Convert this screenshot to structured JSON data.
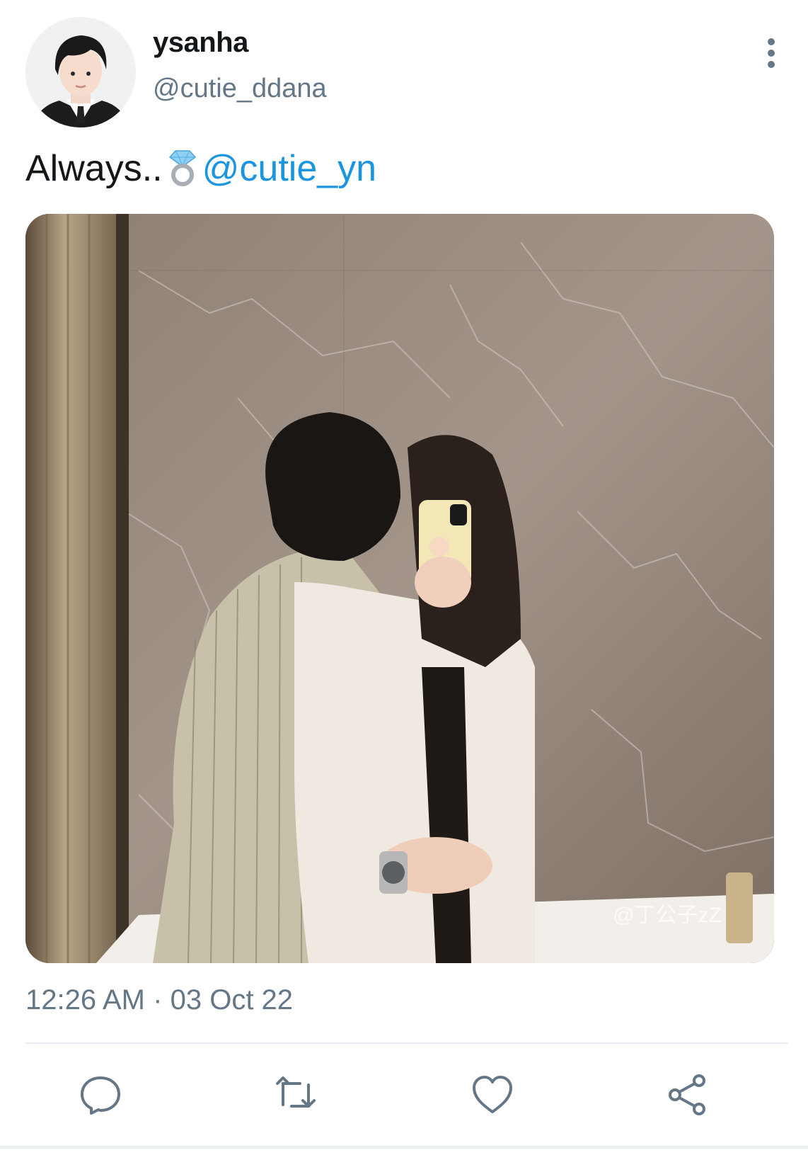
{
  "user": {
    "display_name": "ysanha",
    "handle": "@cutie_ddana"
  },
  "tweet": {
    "text": "Always..",
    "emoji": "ring-icon",
    "mention": "@cutie_yn",
    "watermark": "@丁公子zZ"
  },
  "timestamp": {
    "time": "12:26 AM",
    "separator": "·",
    "date": "03 Oct 22"
  },
  "actions": [
    {
      "name": "reply",
      "icon": "speech-bubble-icon"
    },
    {
      "name": "retweet",
      "icon": "retweet-icon"
    },
    {
      "name": "like",
      "icon": "heart-icon"
    },
    {
      "name": "share",
      "icon": "share-icon"
    }
  ],
  "colors": {
    "mention": "#1b95e0",
    "secondary_text": "#657786",
    "divider": "#e6ecf0"
  }
}
